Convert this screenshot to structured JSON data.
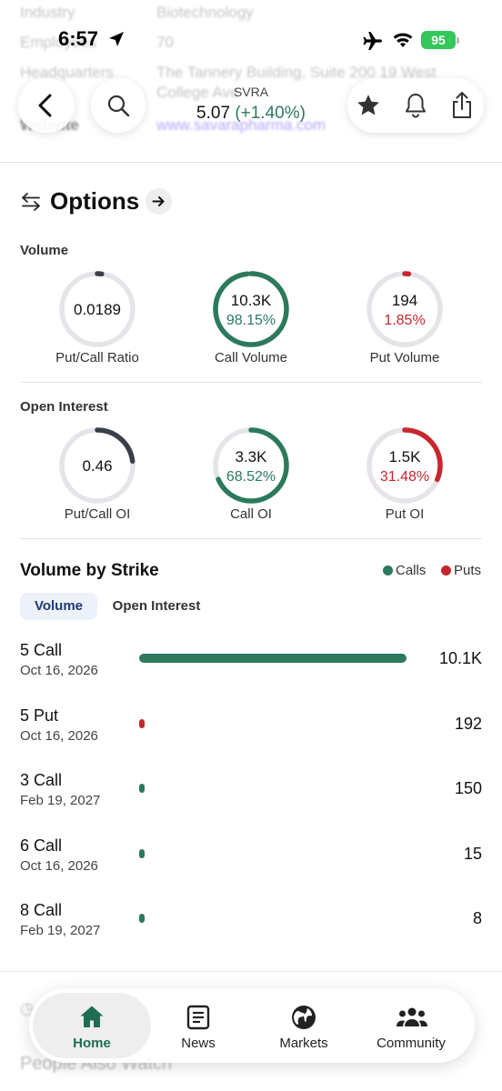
{
  "background_peek": {
    "row1_key": "Industry",
    "row1_val": "Biotechnology",
    "row2_key": "Employees",
    "row2_val": "70",
    "row3_key": "Headquarters",
    "row3_val": "The Tannery Building, Suite 200 19 West",
    "row4_val": "College Ave",
    "row5_key": "Website",
    "row5_val": "www.savarapharma.com"
  },
  "status_bar": {
    "time": "6:57",
    "battery": "95"
  },
  "header": {
    "ticker": "SVRA",
    "price": "5.07",
    "change": "(+1.40%)"
  },
  "options": {
    "title": "Options",
    "volume_label": "Volume",
    "open_interest_label": "Open Interest",
    "volume_gauges": [
      {
        "value": "0.0189",
        "sub": "",
        "caption": "Put/Call Ratio",
        "fraction": 0.02,
        "color": "#3a3f47",
        "sub_color": "#2c7a5b"
      },
      {
        "value": "10.3K",
        "sub": "98.15%",
        "caption": "Call Volume",
        "fraction": 0.9815,
        "color": "#2c7a5b",
        "sub_color": "#2c7a5b"
      },
      {
        "value": "194",
        "sub": "1.85%",
        "caption": "Put Volume",
        "fraction": 0.0185,
        "color": "#c8262e",
        "sub_color": "#c8262e"
      }
    ],
    "oi_gauges": [
      {
        "value": "0.46",
        "sub": "",
        "caption": "Put/Call OI",
        "fraction": 0.23,
        "color": "#3a3f47",
        "sub_color": "#2c7a5b"
      },
      {
        "value": "3.3K",
        "sub": "68.52%",
        "caption": "Call OI",
        "fraction": 0.6852,
        "color": "#2c7a5b",
        "sub_color": "#2c7a5b"
      },
      {
        "value": "1.5K",
        "sub": "31.48%",
        "caption": "Put OI",
        "fraction": 0.3148,
        "color": "#c8262e",
        "sub_color": "#c8262e"
      }
    ]
  },
  "volume_by_strike": {
    "title": "Volume by Strike",
    "legend_calls": "Calls",
    "legend_puts": "Puts",
    "tab_volume": "Volume",
    "tab_open_interest": "Open Interest",
    "call_color": "#2c7a5b",
    "put_color": "#c8262e",
    "rows": [
      {
        "name": "5 Call",
        "date": "Oct 16, 2026",
        "value_label": "10.1K",
        "value": 10100,
        "type": "call"
      },
      {
        "name": "5 Put",
        "date": "Oct 16, 2026",
        "value_label": "192",
        "value": 192,
        "type": "put"
      },
      {
        "name": "3 Call",
        "date": "Feb 19, 2027",
        "value_label": "150",
        "value": 150,
        "type": "call"
      },
      {
        "name": "6 Call",
        "date": "Oct 16, 2026",
        "value_label": "15",
        "value": 15,
        "type": "call"
      },
      {
        "name": "8 Call",
        "date": "Feb 19, 2027",
        "value_label": "8",
        "value": 8,
        "type": "call"
      }
    ]
  },
  "below_peek": {
    "line2": "People Also Watch"
  },
  "nav": {
    "home": "Home",
    "news": "News",
    "markets": "Markets",
    "community": "Community"
  }
}
